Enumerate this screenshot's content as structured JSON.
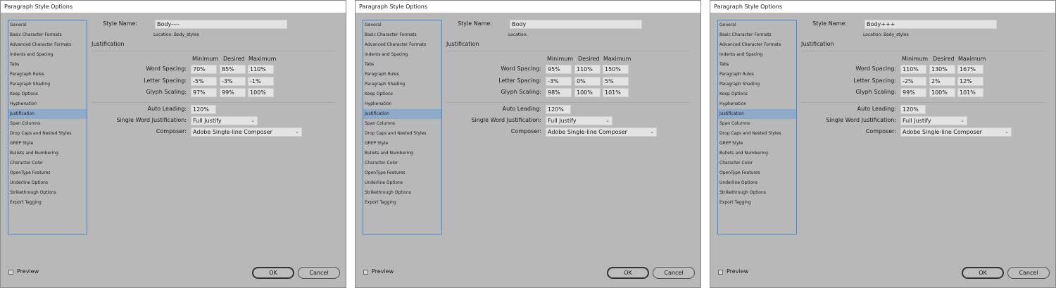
{
  "common": {
    "title": "Paragraph Style Options",
    "sidebar": [
      "General",
      "Basic Character Formats",
      "Advanced Character Formats",
      "Indents and Spacing",
      "Tabs",
      "Paragraph Rules",
      "Paragraph Shading",
      "Keep Options",
      "Hyphenation",
      "Justification",
      "Span Columns",
      "Drop Caps and Nested Styles",
      "GREP Style",
      "Bullets and Numbering",
      "Character Color",
      "OpenType Features",
      "Underline Options",
      "Strikethrough Options",
      "Export Tagging"
    ],
    "selected_index": 9,
    "style_name_label": "Style Name:",
    "location_label": "Location:",
    "section_title": "Justification",
    "col_headers": [
      "Minimum",
      "Desired",
      "Maximum"
    ],
    "row_labels": [
      "Word Spacing:",
      "Letter Spacing:",
      "Glyph Scaling:"
    ],
    "auto_leading_label": "Auto Leading:",
    "single_word_label": "Single Word Justification:",
    "composer_label": "Composer:",
    "preview_label": "Preview",
    "ok_label": "OK",
    "cancel_label": "Cancel"
  },
  "dialogs": [
    {
      "style_name": "Body----",
      "location": "Body_styles",
      "rows": [
        [
          "70%",
          "85%",
          "110%"
        ],
        [
          "-5%",
          "-3%",
          "-1%"
        ],
        [
          "97%",
          "99%",
          "100%"
        ]
      ],
      "auto_leading": "120%",
      "single_word": "Full Justify",
      "composer": "Adobe Single-line Composer"
    },
    {
      "style_name": "Body",
      "location": "",
      "rows": [
        [
          "95%",
          "110%",
          "150%"
        ],
        [
          "-3%",
          "0%",
          "5%"
        ],
        [
          "98%",
          "100%",
          "101%"
        ]
      ],
      "auto_leading": "120%",
      "single_word": "Full Justify",
      "composer": "Adobe Single-line Composer"
    },
    {
      "style_name": "Body+++",
      "location": "Body_styles",
      "rows": [
        [
          "110%",
          "130%",
          "167%"
        ],
        [
          "-2%",
          "2%",
          "12%"
        ],
        [
          "99%",
          "100%",
          "101%"
        ]
      ],
      "auto_leading": "120%",
      "single_word": "Full Justify",
      "composer": "Adobe Single-line Composer"
    }
  ]
}
